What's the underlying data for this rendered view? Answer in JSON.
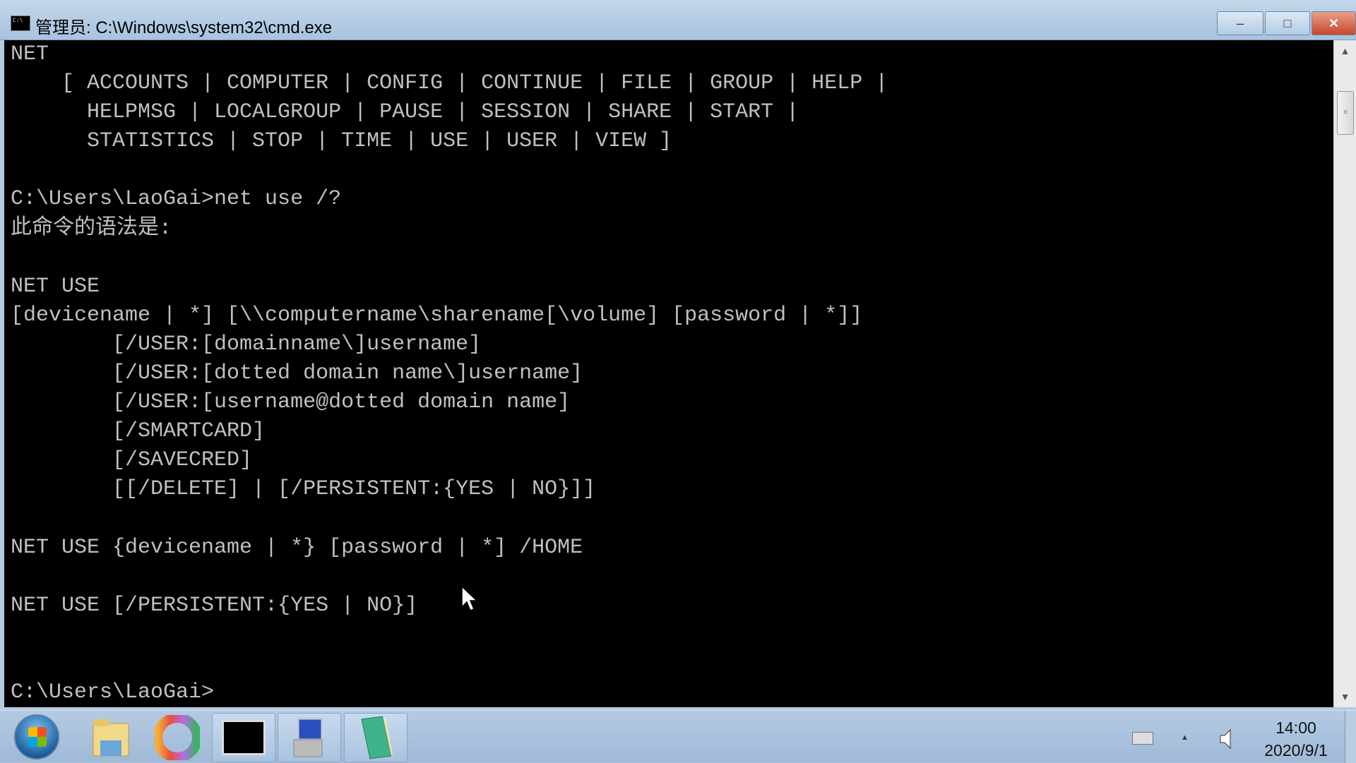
{
  "window": {
    "title": "管理员: C:\\Windows\\system32\\cmd.exe",
    "icon": "cmd-icon",
    "buttons": {
      "minimize": "–",
      "maximize": "□",
      "close": "✕"
    }
  },
  "console": {
    "lines": [
      "NET",
      "    [ ACCOUNTS | COMPUTER | CONFIG | CONTINUE | FILE | GROUP | HELP |",
      "      HELPMSG | LOCALGROUP | PAUSE | SESSION | SHARE | START |",
      "      STATISTICS | STOP | TIME | USE | USER | VIEW ]",
      "",
      "C:\\Users\\LaoGai>net use /?",
      "此命令的语法是:",
      "",
      "NET USE",
      "[devicename | *] [\\\\computername\\sharename[\\volume] [password | *]]",
      "        [/USER:[domainname\\]username]",
      "        [/USER:[dotted domain name\\]username]",
      "        [/USER:[username@dotted domain name]",
      "        [/SMARTCARD]",
      "        [/SAVECRED]",
      "        [[/DELETE] | [/PERSISTENT:{YES | NO}]]",
      "",
      "NET USE {devicename | *} [password | *] /HOME",
      "",
      "NET USE [/PERSISTENT:{YES | NO}]",
      "",
      "",
      "C:\\Users\\LaoGai>"
    ]
  },
  "scrollbar": {
    "up": "▲",
    "down": "▼",
    "thumb": "≡"
  },
  "taskbar": {
    "items": [
      "start-button",
      "file-explorer",
      "browser",
      "command-prompt",
      "network-tool",
      "notebook-app"
    ],
    "tray": {
      "arrow": "▲",
      "time": "14:00",
      "date": "2020/9/1"
    }
  }
}
